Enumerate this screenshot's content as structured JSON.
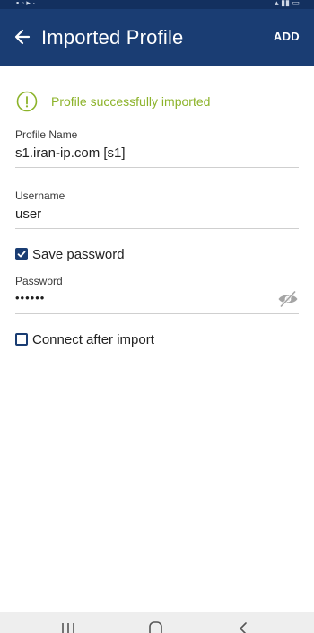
{
  "appbar": {
    "title": "Imported Profile",
    "add_label": "ADD"
  },
  "banner": {
    "message": "Profile successfully imported",
    "icon": "info-icon"
  },
  "form": {
    "profile_name": {
      "label": "Profile Name",
      "value": "s1.iran-ip.com [s1]"
    },
    "username": {
      "label": "Username",
      "value": "user"
    },
    "save_password": {
      "label": "Save password",
      "checked": true
    },
    "password": {
      "label": "Password",
      "value": "••••••",
      "toggle_icon": "eye-off-icon"
    },
    "connect_after_import": {
      "label": "Connect after import",
      "checked": false
    }
  },
  "colors": {
    "appbar": "#1a3d73",
    "success": "#8cb32a",
    "checkbox": "#1a3d73"
  },
  "navbar": {
    "icons": [
      "recent-apps-icon",
      "home-icon",
      "back-nav-icon"
    ]
  }
}
